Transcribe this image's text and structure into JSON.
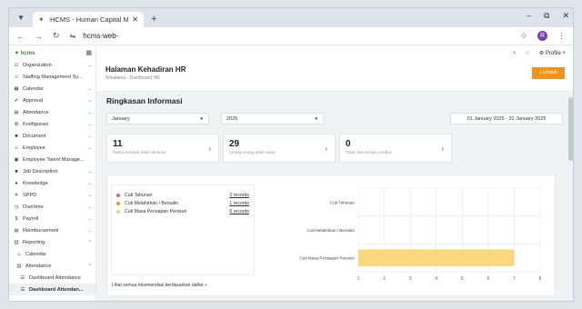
{
  "browser": {
    "tab_title": "HCMS - Human Capital Manag",
    "url": "hcms-web-",
    "avatar_letter": "R",
    "icons": [
      "tab-list-icon",
      "new-tab-icon",
      "minimize-icon",
      "maximize-icon",
      "close-window-icon",
      "back-icon",
      "forward-icon",
      "reload-icon",
      "site-settings-icon",
      "star-icon",
      "menu-dots-icon"
    ]
  },
  "sidebar": {
    "logo_text": "✦ hcms",
    "items": [
      {
        "label": "Organization",
        "icon": "org-icon",
        "glyph": "☷",
        "chev": "⌄"
      },
      {
        "label": "Staffing Management Sy...",
        "icon": "staffing-icon",
        "glyph": "☺",
        "chev": ""
      },
      {
        "label": "Calendar",
        "icon": "calendar-icon",
        "glyph": "▦",
        "chev": "⌄"
      },
      {
        "label": "Approval",
        "icon": "approval-icon",
        "glyph": "✔",
        "chev": "⌄"
      },
      {
        "label": "Attendance",
        "icon": "attendance-icon",
        "glyph": "▤",
        "chev": "⌄"
      },
      {
        "label": "Konfigurasi",
        "icon": "gear-icon",
        "glyph": "⚙",
        "chev": "⌄"
      },
      {
        "label": "Document",
        "icon": "document-icon",
        "glyph": "■",
        "chev": "⌄"
      },
      {
        "label": "Employee",
        "icon": "employee-icon",
        "glyph": "☺",
        "chev": "⌄"
      },
      {
        "label": "Employee Talent Manage...",
        "icon": "talent-icon",
        "glyph": "▣",
        "chev": ""
      },
      {
        "label": "Job Description",
        "icon": "job-icon",
        "glyph": "■",
        "chev": "⌄"
      },
      {
        "label": "Knowledge",
        "icon": "knowledge-icon",
        "glyph": "●",
        "chev": "⌄"
      },
      {
        "label": "SPPD",
        "icon": "sppd-icon",
        "glyph": "✈",
        "chev": "⌄"
      },
      {
        "label": "Overtime",
        "icon": "clock-icon",
        "glyph": "◷",
        "chev": "⌄"
      },
      {
        "label": "Payroll",
        "icon": "payroll-icon",
        "glyph": "$",
        "chev": "⌄"
      },
      {
        "label": "Reimbursement",
        "icon": "reimburse-icon",
        "glyph": "▤",
        "chev": "⌄"
      },
      {
        "label": "Reporting",
        "icon": "report-icon",
        "glyph": "▥",
        "chev": "⌃"
      },
      {
        "label": "Calendar",
        "icon": "calendar-icon",
        "glyph": "☺",
        "chev": "",
        "level": 1
      },
      {
        "label": "Attendance",
        "icon": "attendance-icon",
        "glyph": "▥",
        "chev": "⌃",
        "level": 1
      },
      {
        "label": "Dashboard Attendance",
        "icon": "list-icon",
        "glyph": "☰",
        "chev": "",
        "level": 2
      },
      {
        "label": "Dashboard Attendan...",
        "icon": "list-icon",
        "glyph": "☰",
        "chev": "",
        "level": 2,
        "active": true
      }
    ]
  },
  "topbar": {
    "profile_label": "Profile"
  },
  "header": {
    "title": "Halaman Kehadiran HR",
    "breadcrumb": "Wisatama - Dashboard HR",
    "download_label": "Unduh"
  },
  "summary": {
    "title": "Ringkasan Informasi",
    "month_select": "January",
    "year_select": "2025",
    "date_range": "01 January 2025 - 31 January 2025",
    "cards": [
      {
        "value": "11",
        "desc": "Rekomendasi telah diminta"
      },
      {
        "value": "29",
        "desc": "Orang-orang telah ewat"
      },
      {
        "value": "0",
        "desc": "Total Jam Kerja Lembur"
      }
    ]
  },
  "leave": {
    "items": [
      {
        "name": "Cuti Tahunan",
        "count": "2 records",
        "color": "#f05b7c"
      },
      {
        "name": "Cuti Melahirkan / Bersalin",
        "count": "1 records",
        "color": "#f0931e"
      },
      {
        "name": "Cuti Masa Persiapan Pensiun",
        "count": "6 records",
        "color": "#f7cf6a"
      }
    ],
    "more_link": "Lihat semua rekomendasi berdasarkan daftar »"
  },
  "chart_data": {
    "type": "bar",
    "orientation": "horizontal",
    "categories": [
      "Cuti Tahunan",
      "Cuti Melahirkan / Bersalin",
      "Cuti Masa Persiapan Pensiun"
    ],
    "values": [
      1,
      0,
      7
    ],
    "colors": [
      "#f77f9b",
      "#f0931e",
      "#f9d77e"
    ],
    "xlim": [
      1,
      8
    ],
    "xticks": [
      1,
      2,
      3,
      4,
      5,
      6,
      7,
      8
    ],
    "grid": true
  }
}
